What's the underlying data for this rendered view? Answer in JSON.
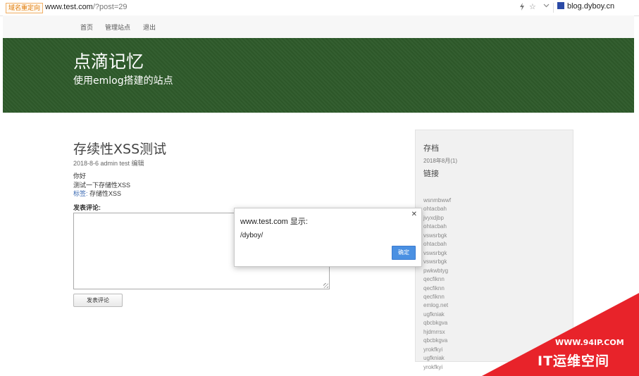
{
  "browser": {
    "redirect_tag": "域名重定向",
    "url_host": "www.test.com",
    "url_query": "/?post=29",
    "bolt_icon": "bolt-icon",
    "star_icon": "star-icon",
    "dropdown_icon": "chevron-down-icon",
    "site_label": "blog.dyboy.cn"
  },
  "nav": {
    "items": [
      "首页",
      "管理站点",
      "退出"
    ]
  },
  "banner": {
    "title": "点滴记忆",
    "subtitle": "使用emlog搭建的站点"
  },
  "post": {
    "title": "存续性XSS测试",
    "meta": "2018-8-6 admin test 编辑",
    "line1": "你好",
    "line2": "测试一下存储性XSS",
    "tags_label": "标签:",
    "tags_value": "存储性XSS",
    "comment_label": "发表评论:",
    "submit_label": "发表评论"
  },
  "sidebar": {
    "archive_heading": "存档",
    "archive_item": "2018年8月(1)",
    "links_heading": "链接",
    "links": [
      "wsnmbwwf",
      "ohtacbah",
      "jvyxdjbp",
      "ohtacbah",
      "vswsrbgk",
      "ohtacbah",
      "vswsrbgk",
      "vswsrbgk",
      "pwkwbtyg",
      "qecfiknn",
      "qecfiknn",
      "qecfiknn",
      "emlog.net",
      "ugfkniak",
      "qbcbkgva",
      "hjdmrrsx",
      "qbcbkgva",
      "yrokfkyi",
      "ugfkniak",
      "yrokfkyi"
    ]
  },
  "dialog": {
    "title": "www.test.com 显示:",
    "message": "/dyboy/",
    "close_icon": "close-icon",
    "ok_label": "确定"
  },
  "watermark": {
    "url": "WWW.94IP.COM",
    "name": "IT运维空间"
  },
  "colors": {
    "banner": "#2e5a2a",
    "watermark": "#e8232a",
    "ok_button": "#4a90e2"
  }
}
